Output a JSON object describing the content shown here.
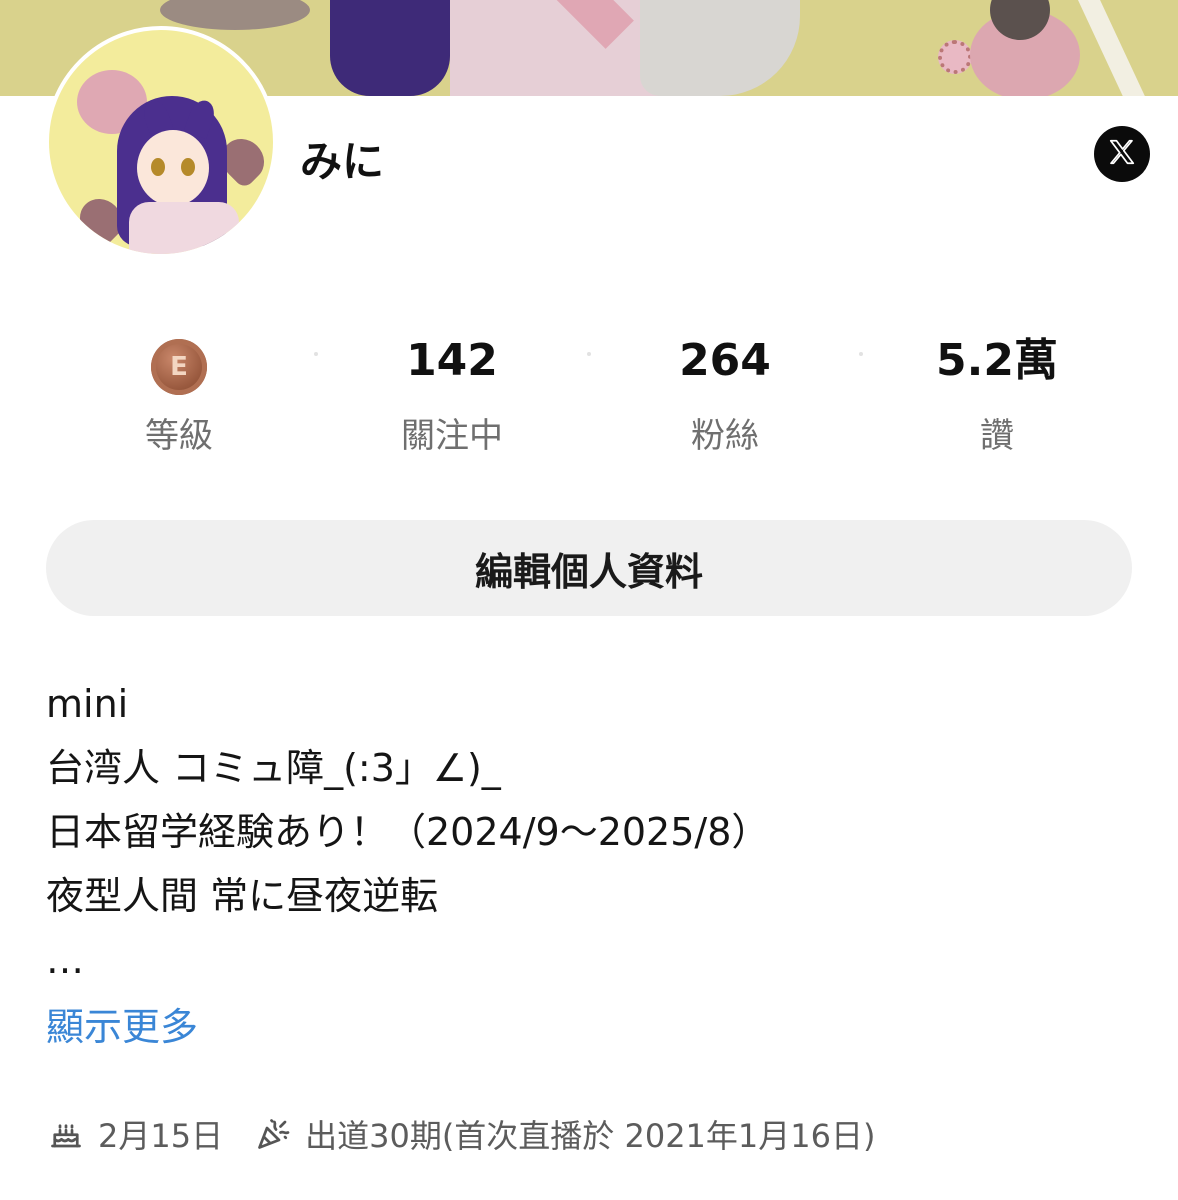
{
  "profile": {
    "name": "みに"
  },
  "social": {
    "x_icon": "x-logo-icon"
  },
  "stats": {
    "level": {
      "badge": "E",
      "label": "等級"
    },
    "following": {
      "value": "142",
      "label": "關注中"
    },
    "followers": {
      "value": "264",
      "label": "粉絲"
    },
    "likes": {
      "value": "5.2萬",
      "label": "讚"
    }
  },
  "actions": {
    "edit_profile": "編輯個人資料"
  },
  "bio": {
    "lines": [
      "mini",
      "台湾人 コミュ障_(:3」∠)_",
      "日本留学経験あり！（2024/9～2025/8）",
      "夜型人間 常に昼夜逆転",
      "…"
    ],
    "show_more": "顯示更多"
  },
  "meta": {
    "birthday": "2月15日",
    "debut": "出道30期(首次直播於 2021年1月16日)",
    "birthday_icon": "cake-icon",
    "debut_icon": "party-popper-icon"
  },
  "colors": {
    "link": "#3a86d6",
    "button_bg": "#f0f0f0",
    "muted_text": "#6f6f6f"
  }
}
